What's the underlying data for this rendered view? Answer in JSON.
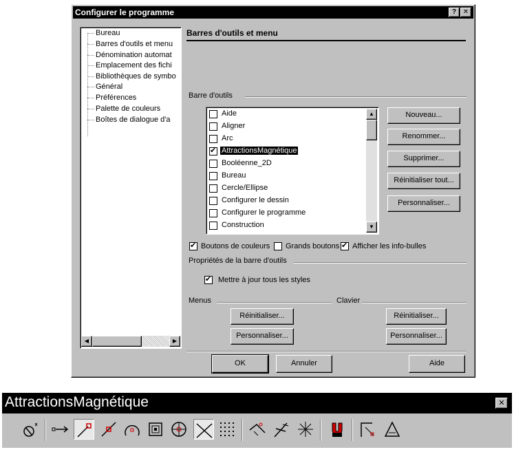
{
  "dialog": {
    "title": "Configurer le programme",
    "help_btn": "?",
    "close_btn": "✕",
    "tree_items": [
      "Bureau",
      "Barres d'outils et menu",
      "Dénomination automat",
      "Emplacement des fichi",
      "Bibliothèques de symbo",
      "Général",
      "Préférences",
      "Palette de couleurs",
      "Boîtes de dialogue d'a"
    ],
    "section_title": "Barres d'outils et menu",
    "toolbar_group_label": "Barre d'outils",
    "toolbars": [
      {
        "label": "Aide",
        "checked": false
      },
      {
        "label": "Aligner",
        "checked": false
      },
      {
        "label": "Arc",
        "checked": false
      },
      {
        "label": "AttractionsMagnétique",
        "checked": true,
        "selected": true
      },
      {
        "label": "Booléenne_2D",
        "checked": false
      },
      {
        "label": "Bureau",
        "checked": false
      },
      {
        "label": "Cercle/Ellipse",
        "checked": false
      },
      {
        "label": "Configurer le dessin",
        "checked": false
      },
      {
        "label": "Configurer le programme",
        "checked": false
      },
      {
        "label": "Construction",
        "checked": false
      }
    ],
    "buttons": {
      "nouveau": "Nouveau...",
      "renommer": "Renommer...",
      "supprimer": "Supprimer...",
      "reinit_tout": "Réinitialiser tout...",
      "personnaliser": "Personnaliser..."
    },
    "options": {
      "boutons_couleurs": "Boutons de couleurs",
      "grands_boutons": "Grands boutons",
      "info_bulles": "Afficher les info-bulles"
    },
    "proprietes_label": "Propriétés de la barre d'outils",
    "mettre_a_jour": "Mettre à jour tous les styles",
    "menus_label": "Menus",
    "clavier_label": "Clavier",
    "menus_reinit": "Réinitialiser...",
    "menus_perso": "Personnaliser...",
    "clavier_reinit": "Réinitialiser...",
    "clavier_perso": "Personnaliser...",
    "ok": "OK",
    "annuler": "Annuler",
    "aide": "Aide"
  },
  "toolbar_window": {
    "title": "AttractionsMagnétique",
    "close_btn": "✕",
    "tools": [
      "snap-toggle-icon",
      "snap-to-free-icon",
      "snap-to-endpoint-icon",
      "snap-to-midpoint-icon",
      "snap-to-center-icon",
      "snap-to-object-icon",
      "snap-to-quadrant-icon",
      "snap-to-intersection-icon",
      "snap-to-grid-icon",
      "snap-to-tangent-icon",
      "snap-to-perpendicular-icon",
      "snap-to-nearest-icon",
      "magnet-icon",
      "snap-angle-icon",
      "snap-triangle-icon"
    ]
  }
}
